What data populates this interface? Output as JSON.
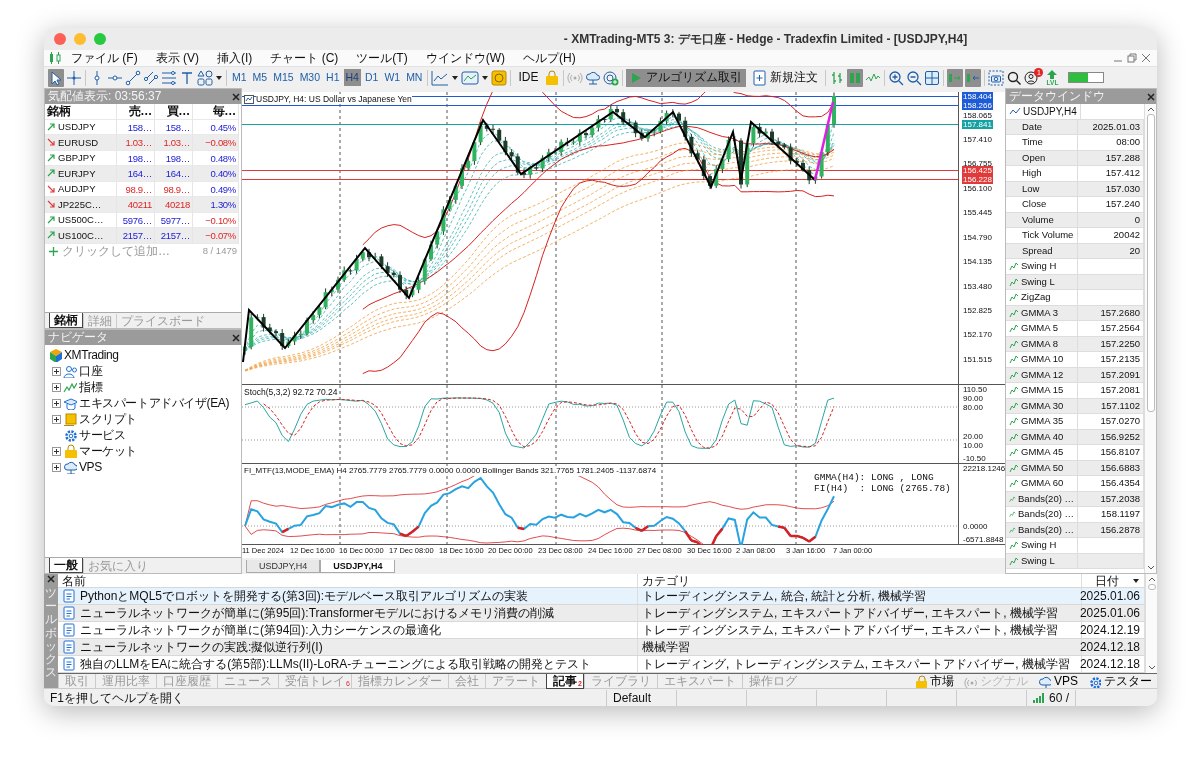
{
  "window": {
    "title": "- XMTrading-MT5 3: デモ口座 - Hedge - Tradexfin Limited - [USDJPY,H4]"
  },
  "menu": [
    "ファイル (F)",
    "表示 (V)",
    "挿入(I)",
    "チャート (C)",
    "ツール(T)",
    "ウインドウ(W)",
    "ヘルプ(H)"
  ],
  "toolbar": {
    "drawing_tools": [
      {
        "selected": true
      },
      {
        "selected": false
      },
      {
        "selected": false
      },
      {
        "selected": false
      },
      {
        "selected": false
      },
      {
        "selected": false
      },
      {
        "selected": false
      },
      {
        "selected": false
      },
      {
        "selected": false
      }
    ],
    "timeframes": [
      {
        "label": "M1",
        "selected": false
      },
      {
        "label": "M5",
        "selected": false
      },
      {
        "label": "M15",
        "selected": false
      },
      {
        "label": "M30",
        "selected": false
      },
      {
        "label": "H1",
        "selected": false
      },
      {
        "label": "H4",
        "selected": true
      },
      {
        "label": "D1",
        "selected": false
      },
      {
        "label": "W1",
        "selected": false
      },
      {
        "label": "MN",
        "selected": false
      }
    ],
    "ide": "IDE",
    "algo_trading": {
      "label": "アルゴリズム取引",
      "on": true
    },
    "new_order": "新規注文",
    "chart_types": [
      {
        "selected": false
      },
      {
        "selected": true
      },
      {
        "selected": false
      }
    ],
    "autoscroll": true,
    "chart_shift": true,
    "account_badge": "1",
    "level_label": "LVL",
    "meter": {
      "level": 0.55
    }
  },
  "market_watch": {
    "title": "気配値表示: 03:56:37",
    "columns": [
      "銘柄",
      "売…",
      "買…",
      "毎…"
    ],
    "rows": [
      {
        "symbol": "USDJPY",
        "rising": true,
        "bid": "158…",
        "ask": "158…",
        "change": "0.45%",
        "change_up": true
      },
      {
        "symbol": "EURUSD",
        "rising": false,
        "bid": "1.03…",
        "ask": "1.03…",
        "change": "−0.08%",
        "change_up": false
      },
      {
        "symbol": "GBPJPY",
        "rising": true,
        "bid": "198…",
        "ask": "198…",
        "change": "0.48%",
        "change_up": true
      },
      {
        "symbol": "EURJPY",
        "rising": true,
        "bid": "164…",
        "ask": "164…",
        "change": "0.40%",
        "change_up": true
      },
      {
        "symbol": "AUDJPY",
        "rising": false,
        "bid": "98.9…",
        "ask": "98.9…",
        "change": "0.49%",
        "change_up": true
      },
      {
        "symbol": "JP225C…",
        "rising": false,
        "bid": "40211",
        "ask": "40218",
        "change": "1.30%",
        "change_up": true
      },
      {
        "symbol": "US500C…",
        "rising": true,
        "bid": "5976…",
        "ask": "5977…",
        "change": "−0.10%",
        "change_up": false
      },
      {
        "symbol": "US100C…",
        "rising": true,
        "bid": "2157…",
        "ask": "2157…",
        "change": "−0.07%",
        "change_up": false
      }
    ],
    "add_placeholder": "クリックして追加…",
    "count": "8 / 1479",
    "tabs": [
      {
        "label": "銘柄",
        "selected": true
      },
      {
        "label": "詳細",
        "selected": false
      },
      {
        "label": "プライスボード",
        "selected": false
      }
    ]
  },
  "navigator": {
    "title": "ナビゲータ",
    "root": {
      "label": "XMTrading",
      "children": [
        {
          "label": "口座",
          "kind": "group",
          "expanded": false
        },
        {
          "label": "指標",
          "kind": "group",
          "expanded": false
        },
        {
          "label": "エキスパートアドバイザ(EA)",
          "kind": "group",
          "expanded": false
        },
        {
          "label": "スクリプト",
          "kind": "group",
          "expanded": false
        },
        {
          "label": "サービス",
          "kind": "item"
        },
        {
          "label": "マーケット",
          "kind": "group",
          "expanded": false
        },
        {
          "label": "VPS",
          "kind": "group",
          "expanded": false
        }
      ]
    },
    "tabs": [
      {
        "label": "一般",
        "selected": true
      },
      {
        "label": "お気に入り",
        "selected": false
      }
    ]
  },
  "chart": {
    "legend": "USDJPY, H4: US Dollar vs Japanese Yen",
    "price_axis": {
      "ticks": [
        "158.065",
        "157.410",
        "156.755",
        "156.100",
        "155.445",
        "154.790",
        "154.135",
        "153.480",
        "152.825",
        "152.170",
        "151.515"
      ],
      "markers": [
        {
          "label": "158.404",
          "color": "#1e5bd6"
        },
        {
          "label": "158.266",
          "color": "#1e5bd6"
        },
        {
          "label": "157.841",
          "color": "#16a2a2"
        },
        {
          "label": "156.425",
          "color": "#e03a3a"
        },
        {
          "label": "156.228",
          "color": "#e03a3a"
        }
      ]
    },
    "stoch": {
      "legend": "Stoch(5,3,2) 92.72 70.24",
      "ticks": [
        "110.50",
        "90.00",
        "80.00",
        "20.00",
        "10.00",
        "-10.50"
      ]
    },
    "force": {
      "legend": "FI_MTF(13,MODE_EMA) H4 2765.7779 2765.7779 0.0000 0.0000 Bollinger Bands 321.7765 1781.2405 -1137.6874",
      "ticks": [
        "22218.1246",
        "0.0000",
        "-6571.8848"
      ],
      "signals": [
        "GMMA(H4): LONG , LONG",
        "FI(H4)  : LONG (2765.78)"
      ]
    },
    "dates": [
      "11 Dec 2024",
      "12 Dec 16:00",
      "16 Dec 00:00",
      "17 Dec 08:00",
      "18 Dec 16:00",
      "20 Dec 00:00",
      "23 Dec 08:00",
      "24 Dec 16:00",
      "27 Dec 08:00",
      "30 Dec 16:00",
      "2 Jan 08:00",
      "3 Jan 16:00",
      "7 Jan 00:00"
    ],
    "tabs": [
      {
        "label": "USDJPY,H4",
        "selected": false
      },
      {
        "label": "USDJPY,H4",
        "selected": true
      }
    ]
  },
  "data_window": {
    "title": "データウインドウ",
    "header": "USDJPY,H4",
    "rows": [
      {
        "kind": "field",
        "label": "Date",
        "value": "2025.01.03"
      },
      {
        "kind": "field",
        "label": "Time",
        "value": "08:00"
      },
      {
        "kind": "field",
        "label": "Open",
        "value": "157.288"
      },
      {
        "kind": "field",
        "label": "High",
        "value": "157.412"
      },
      {
        "kind": "field",
        "label": "Low",
        "value": "157.030"
      },
      {
        "kind": "field",
        "label": "Close",
        "value": "157.240"
      },
      {
        "kind": "field",
        "label": "Volume",
        "value": "0"
      },
      {
        "kind": "field",
        "label": "Tick Volume",
        "value": "20042"
      },
      {
        "kind": "field",
        "label": "Spread",
        "value": "20"
      },
      {
        "kind": "indicator",
        "label": "Swing H"
      },
      {
        "kind": "indicator",
        "label": "Swing L"
      },
      {
        "kind": "indicator",
        "label": "ZigZag"
      },
      {
        "kind": "indicator",
        "label": "GMMA 3",
        "value": "157.2680"
      },
      {
        "kind": "indicator",
        "label": "GMMA 5",
        "value": "157.2564"
      },
      {
        "kind": "indicator",
        "label": "GMMA 8",
        "value": "157.2250"
      },
      {
        "kind": "indicator",
        "label": "GMMA 10",
        "value": "157.2135"
      },
      {
        "kind": "indicator",
        "label": "GMMA 12",
        "value": "157.2091"
      },
      {
        "kind": "indicator",
        "label": "GMMA 15",
        "value": "157.2081"
      },
      {
        "kind": "indicator",
        "label": "GMMA 30",
        "value": "157.1102"
      },
      {
        "kind": "indicator",
        "label": "GMMA 35",
        "value": "157.0270"
      },
      {
        "kind": "indicator",
        "label": "GMMA 40",
        "value": "156.9252"
      },
      {
        "kind": "indicator",
        "label": "GMMA 45",
        "value": "156.8107"
      },
      {
        "kind": "indicator",
        "label": "GMMA 50",
        "value": "156.6883"
      },
      {
        "kind": "indicator",
        "label": "GMMA 60",
        "value": "156.4354"
      },
      {
        "kind": "indicator",
        "label": "Bands(20) …",
        "value": "157.2038"
      },
      {
        "kind": "indicator",
        "label": "Bands(20) …",
        "value": "158.1197"
      },
      {
        "kind": "indicator",
        "label": "Bands(20) …",
        "value": "156.2878"
      },
      {
        "kind": "indicator",
        "label": "Swing H"
      },
      {
        "kind": "indicator",
        "label": "Swing L"
      }
    ]
  },
  "toolbox": {
    "title": "ツールボックス",
    "columns": [
      "名前",
      "カテゴリ",
      "日付"
    ],
    "rows": [
      {
        "name": "PythonとMQL5でロボットを開発する(第3回):モデルベース取引アルゴリズムの実装",
        "category": "トレーディングシステム, 統合, 統計と分析, 機械学習",
        "date": "2025.01.06",
        "selected": true
      },
      {
        "name": "ニューラルネットワークが簡単に(第95回):Transformerモデルにおけるメモリ消費の削減",
        "category": "トレーディングシステム, エキスパートアドバイザー, エキスパート, 機械学習",
        "date": "2025.01.06",
        "selected": false
      },
      {
        "name": "ニューラルネットワークが簡単に(第94回):入力シーケンスの最適化",
        "category": "トレーディングシステム, エキスパートアドバイザー, エキスパート, 機械学習",
        "date": "2024.12.19",
        "selected": false
      },
      {
        "name": "ニューラルネットワークの実践:擬似逆行列(I)",
        "category": "機械学習",
        "date": "2024.12.18",
        "selected": false
      },
      {
        "name": "独自のLLMをEAに統合する(第5部):LLMs(II)-LoRA-チューニングによる取引戦略の開発とテスト",
        "category": "トレーディング, トレーディングシステム, エキスパートアドバイザー, 機械学習",
        "date": "2024.12.18",
        "selected": false
      }
    ],
    "tabs": [
      {
        "label": "取引",
        "selected": false
      },
      {
        "label": "運用比率",
        "selected": false
      },
      {
        "label": "口座履歴",
        "selected": false
      },
      {
        "label": "ニュース",
        "selected": false
      },
      {
        "label": "受信トレイ",
        "selected": false,
        "badge": "6"
      },
      {
        "label": "指標カレンダー",
        "selected": false
      },
      {
        "label": "会社",
        "selected": false
      },
      {
        "label": "アラート",
        "selected": false
      },
      {
        "label": "記事",
        "selected": true,
        "badge": "2"
      },
      {
        "label": "ライブラリ",
        "selected": false
      },
      {
        "label": "エキスパート",
        "selected": false
      },
      {
        "label": "操作ログ",
        "selected": false
      }
    ],
    "services": [
      {
        "label": "市場",
        "disabled": false
      },
      {
        "label": "シグナル",
        "disabled": true
      },
      {
        "label": "VPS",
        "disabled": false
      },
      {
        "label": "テスター",
        "disabled": false
      }
    ]
  },
  "status_bar": {
    "help": "F1を押してヘルプを開く",
    "profile": "Default",
    "ping": "60 /"
  }
}
